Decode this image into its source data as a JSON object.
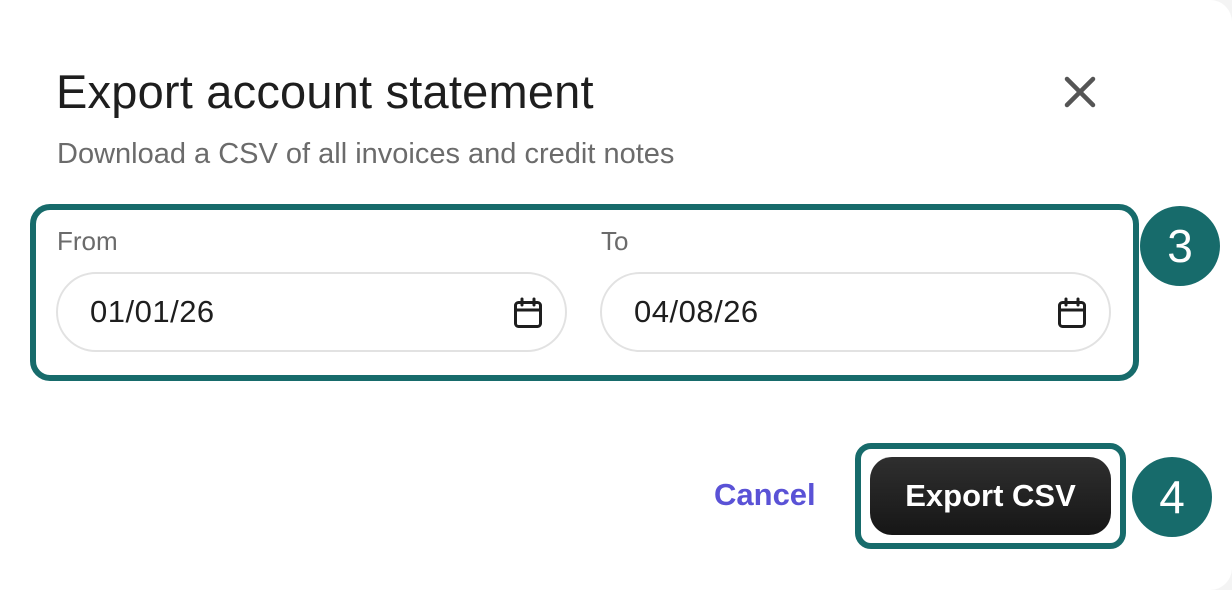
{
  "dialog": {
    "title": "Export account statement",
    "subtitle": "Download a CSV of all invoices and credit notes",
    "close_icon": "close-icon"
  },
  "date_range": {
    "from": {
      "label": "From",
      "value": "01/01/26",
      "icon": "calendar-icon"
    },
    "to": {
      "label": "To",
      "value": "04/08/26",
      "icon": "calendar-icon"
    }
  },
  "actions": {
    "cancel_label": "Cancel",
    "export_label": "Export CSV"
  },
  "step_badges": {
    "dates": "3",
    "export": "4"
  },
  "colors": {
    "highlight": "#176b6b",
    "cancel_text": "#5a52d6",
    "export_bg": "#1e1e1e"
  }
}
